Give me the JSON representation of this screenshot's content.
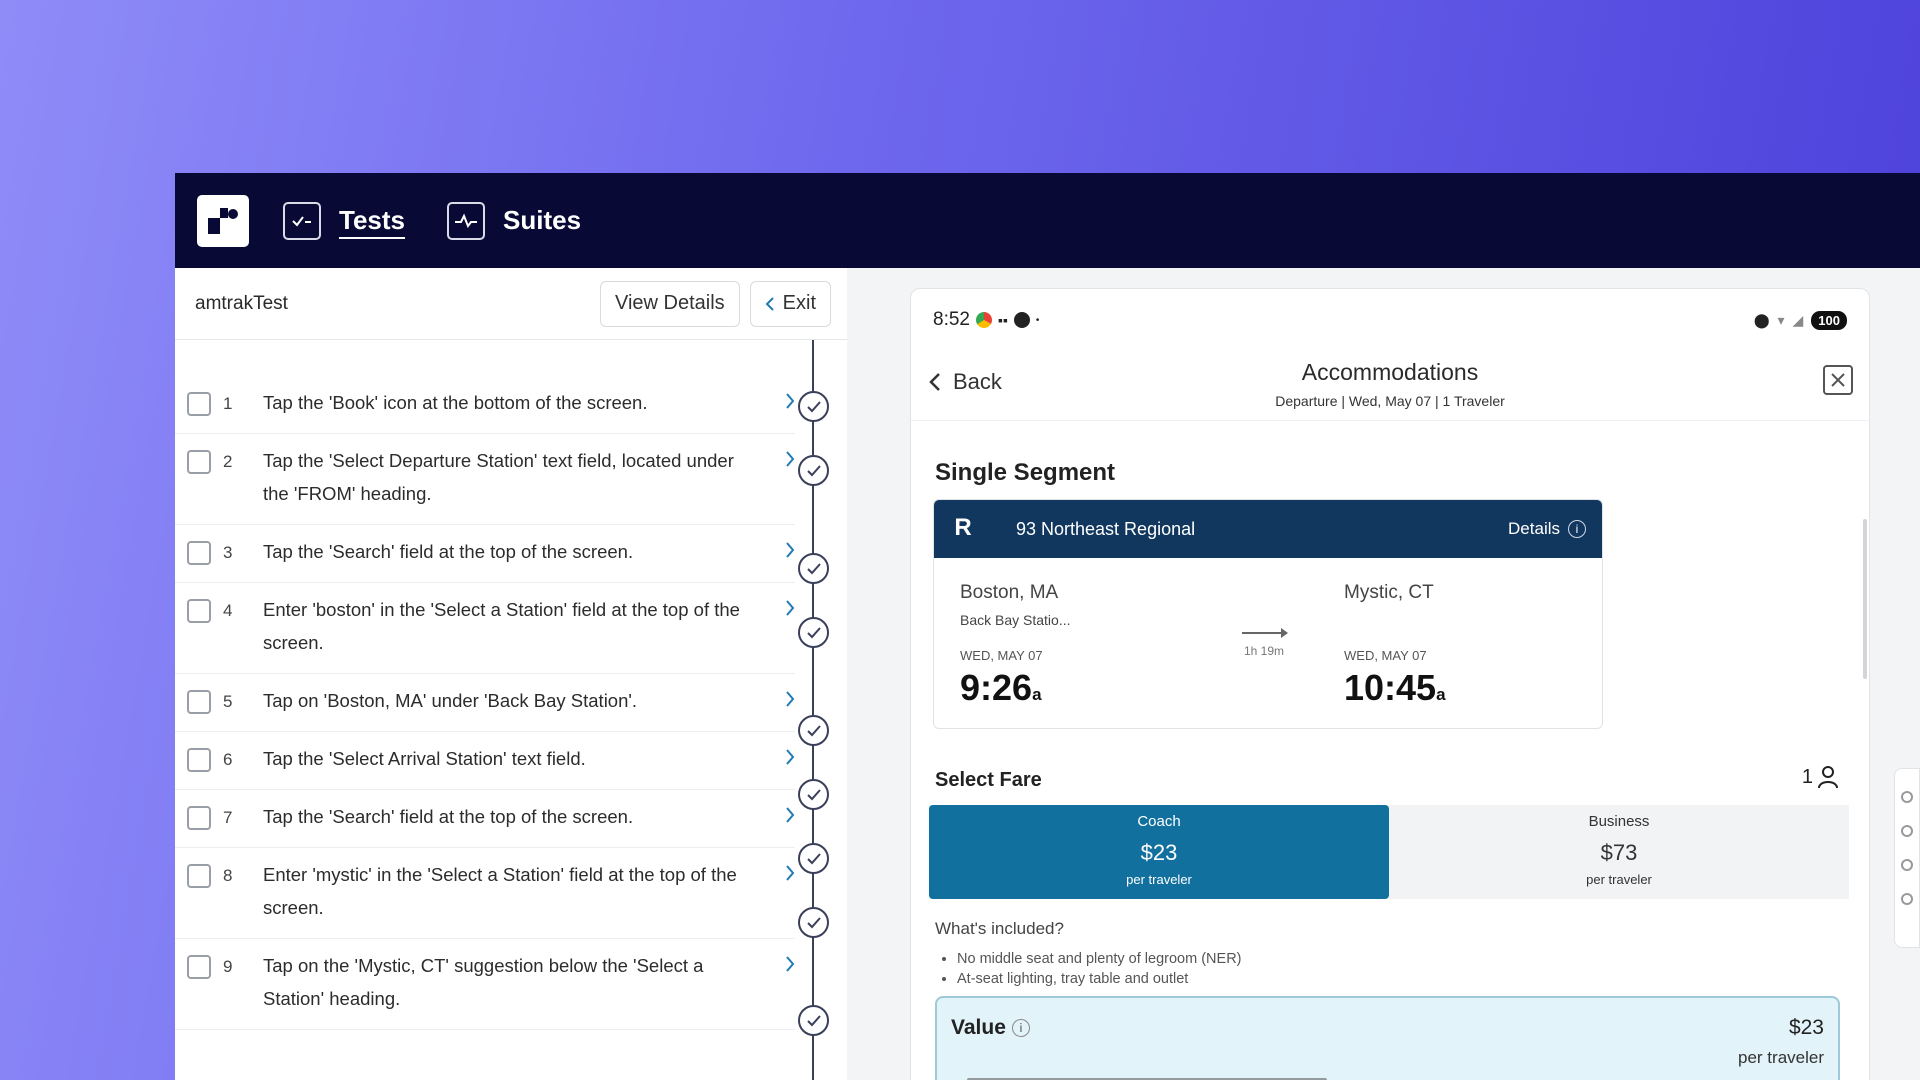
{
  "nav": {
    "tabs": [
      {
        "label": "Tests",
        "active": true,
        "icon": "checklist-icon"
      },
      {
        "label": "Suites",
        "active": false,
        "icon": "activity-icon"
      }
    ]
  },
  "test": {
    "name": "amtrakTest",
    "view_details": "View Details",
    "exit": "Exit"
  },
  "steps": [
    {
      "num": "1",
      "text": "Tap the 'Book' icon at the bottom of the screen."
    },
    {
      "num": "2",
      "text": "Tap the 'Select Departure Station' text field, located under the 'FROM' heading."
    },
    {
      "num": "3",
      "text": "Tap the 'Search' field at the top of the screen."
    },
    {
      "num": "4",
      "text": "Enter 'boston' in the 'Select a Station' field at the top of the screen."
    },
    {
      "num": "5",
      "text": "Tap on 'Boston, MA' under 'Back Bay Station'."
    },
    {
      "num": "6",
      "text": "Tap the 'Select Arrival Station' text field."
    },
    {
      "num": "7",
      "text": "Tap the 'Search' field at the top of the screen."
    },
    {
      "num": "8",
      "text": "Enter 'mystic' in the 'Select a Station' field at the top of the screen."
    },
    {
      "num": "9",
      "text": "Tap on the 'Mystic, CT' suggestion below the 'Select a Station' heading."
    }
  ],
  "phone": {
    "status_time": "8:52",
    "battery": "100",
    "back": "Back",
    "title": "Accommodations",
    "subtitle": "Departure | Wed, May 07 | 1 Traveler",
    "section": "Single Segment",
    "train": {
      "name": "93 Northeast Regional",
      "details": "Details",
      "logo": "R",
      "from_city": "Boston, MA",
      "from_station": "Back Bay Statio...",
      "from_date": "WED, MAY 07",
      "from_time": "9:26",
      "from_suffix": "a",
      "duration": "1h 19m",
      "to_city": "Mystic, CT",
      "to_date": "WED, MAY 07",
      "to_time": "10:45",
      "to_suffix": "a"
    },
    "select_fare": "Select Fare",
    "traveler_count": "1",
    "fares": [
      {
        "name": "Coach",
        "price": "$23",
        "per": "per traveler",
        "selected": true
      },
      {
        "name": "Business",
        "price": "$73",
        "per": "per traveler",
        "selected": false
      }
    ],
    "included_title": "What's included?",
    "included": [
      "No middle seat and plenty of legroom (NER)",
      "At-seat lighting, tray table and outlet"
    ],
    "value": {
      "title": "Value",
      "price": "$23",
      "per": "per traveler"
    }
  },
  "colors": {
    "topbar": "#080a35",
    "coach_selected": "#11709e",
    "train_header": "#12375f",
    "step_chevron": "#1f7ab7"
  }
}
